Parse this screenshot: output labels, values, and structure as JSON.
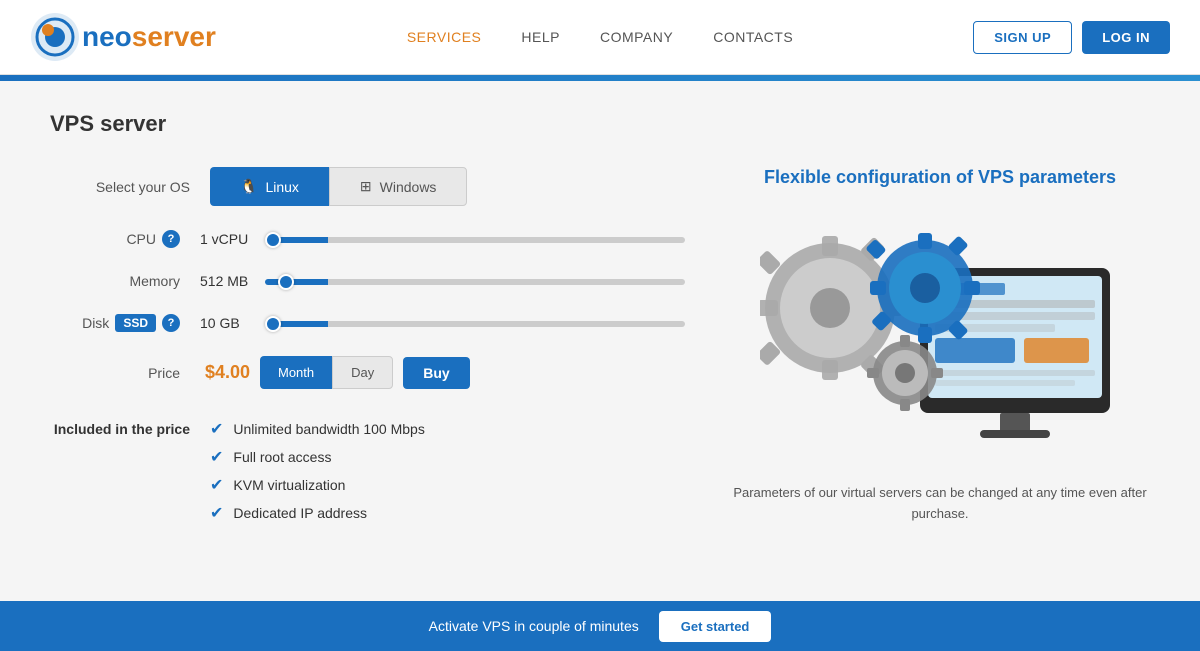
{
  "header": {
    "logo_neo": "neo",
    "logo_server": "server",
    "nav": {
      "services": "SERVICES",
      "help": "HELP",
      "company": "COMPANY",
      "contacts": "CONTACTS"
    },
    "signup": "SIGN UP",
    "login": "LOG IN"
  },
  "page": {
    "title": "VPS server"
  },
  "os": {
    "label": "Select your OS",
    "linux": "Linux",
    "windows": "Windows"
  },
  "cpu": {
    "label": "CPU",
    "value": "1 vCPU",
    "slider_pct": "15"
  },
  "memory": {
    "label": "Memory",
    "value": "512 MB",
    "slider_pct": "15"
  },
  "disk": {
    "label": "Disk",
    "badge": "SSD",
    "value": "10 GB",
    "slider_pct": "15"
  },
  "price": {
    "label": "Price",
    "value": "$4.00",
    "month": "Month",
    "day": "Day",
    "buy": "Buy"
  },
  "included": {
    "label": "Included in the price",
    "items": [
      "Unlimited bandwidth 100 Mbps",
      "Full root access",
      "KVM virtualization",
      "Dedicated IP address"
    ]
  },
  "right": {
    "title": "Flexible configuration of VPS parameters",
    "description": "Parameters of our virtual servers can be changed\nat any time even after purchase."
  },
  "footer": {
    "text": "Activate VPS in couple of minutes",
    "cta": "Get started"
  }
}
